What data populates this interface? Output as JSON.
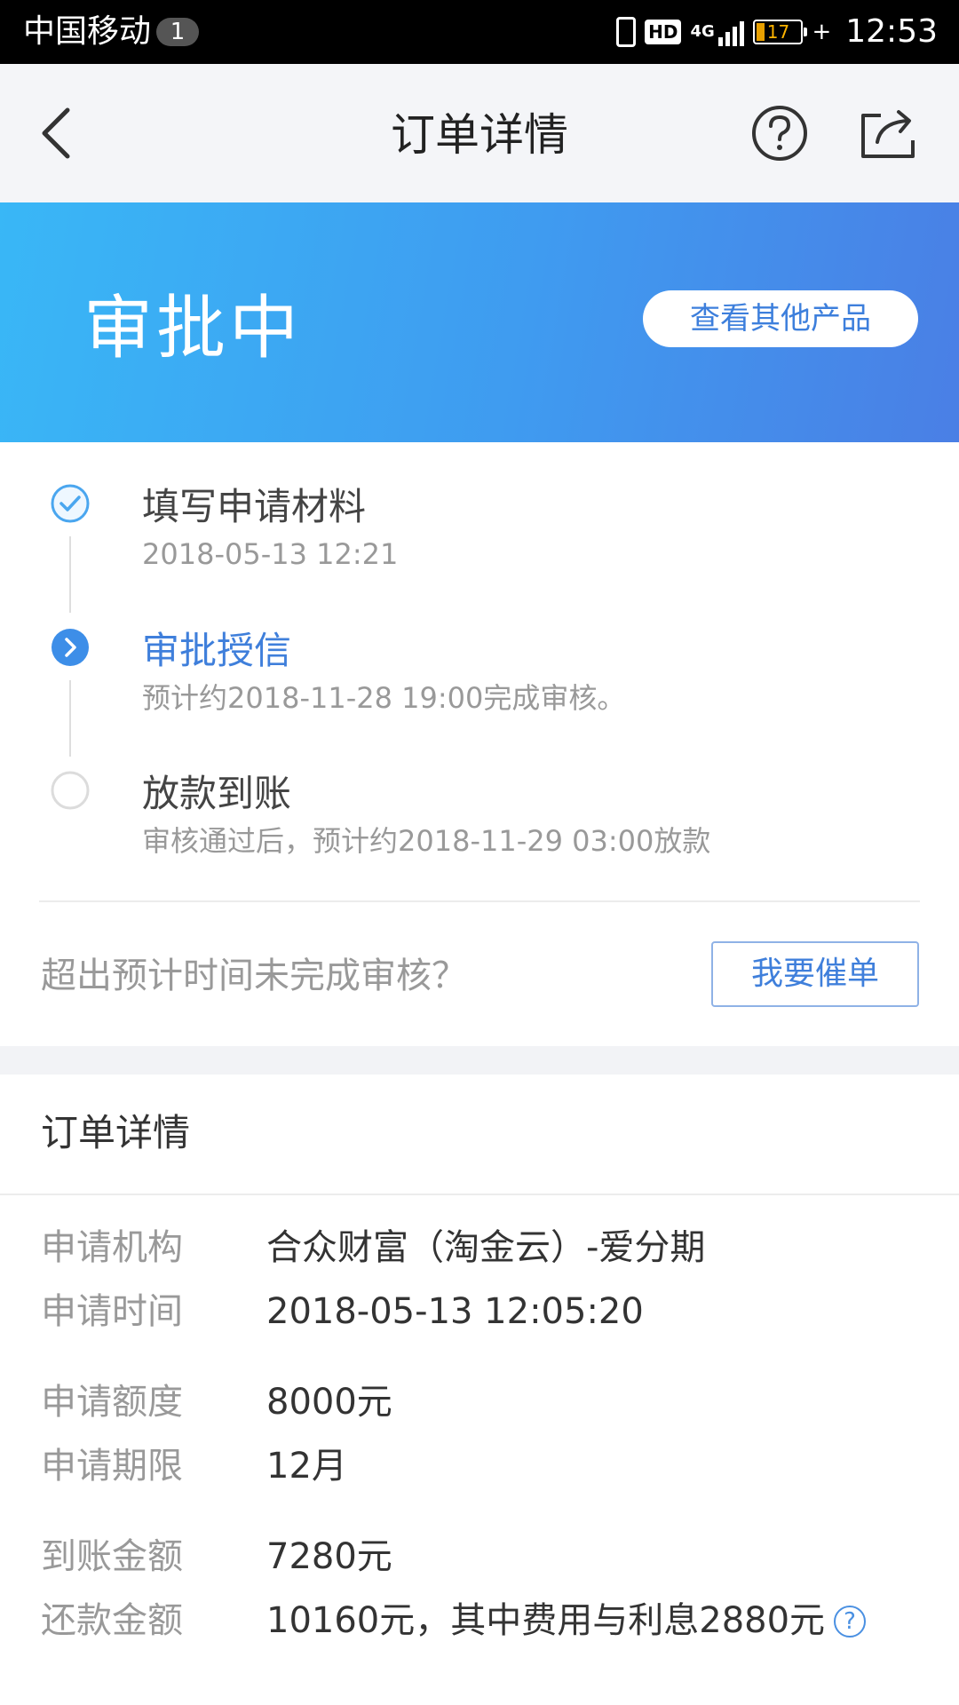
{
  "status_bar": {
    "carrier": "中国移动",
    "notification_count": "1",
    "network": "4G",
    "hd": "HD",
    "battery_level": "17",
    "time": "12:53"
  },
  "nav": {
    "title": "订单详情",
    "back_icon": "chevron-left-icon",
    "help_icon": "question-circle-icon",
    "share_icon": "share-icon"
  },
  "hero": {
    "status": "审批中",
    "view_other_label": "查看其他产品",
    "gradient": [
      "#39b7f6",
      "#4a7fe5"
    ]
  },
  "timeline": [
    {
      "title": "填写申请材料",
      "subtitle": "2018-05-13 12:21",
      "state": "done"
    },
    {
      "title": "审批授信",
      "subtitle": "预计约2018-11-28 19:00完成审核。",
      "state": "current"
    },
    {
      "title": "放款到账",
      "subtitle": "审核通过后，预计约2018-11-29 03:00放款",
      "state": "pending"
    }
  ],
  "urge": {
    "question": "超出预计时间未完成审核？",
    "button_label": "我要催单"
  },
  "order_details": {
    "title": "订单详情",
    "rows": [
      {
        "label": "申请机构",
        "value": "合众财富（淘金云）-爱分期"
      },
      {
        "label": "申请时间",
        "value": "2018-05-13 12:05:20"
      },
      {
        "label": "申请额度",
        "value": "8000元"
      },
      {
        "label": "申请期限",
        "value": "12月"
      },
      {
        "label": "到账金额",
        "value": "7280元"
      },
      {
        "label": "还款金额",
        "value": "10160元，其中费用与利息2880元"
      }
    ]
  },
  "colors": {
    "accent": "#3f7fdb",
    "muted_text": "#999999"
  }
}
